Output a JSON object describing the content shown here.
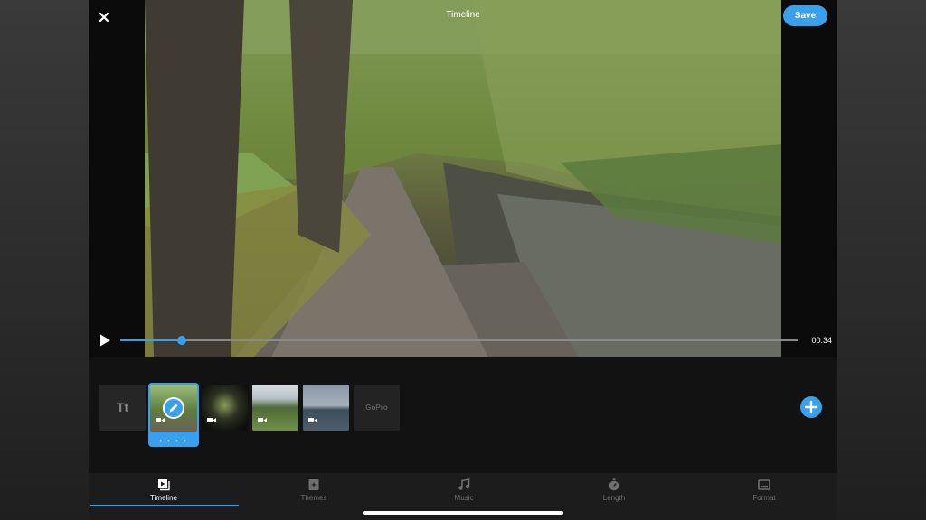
{
  "header": {
    "title": "Timeline",
    "save_label": "Save"
  },
  "player": {
    "current_time": "00:34",
    "progress": 0.09
  },
  "clips": {
    "title_card_label": "Tt",
    "selected_indicator": "• • • •",
    "logo_text": "GoPro"
  },
  "tabs": [
    {
      "label": "Timeline",
      "icon": "timeline-icon",
      "active": true
    },
    {
      "label": "Themes",
      "icon": "themes-icon",
      "active": false
    },
    {
      "label": "Music",
      "icon": "music-icon",
      "active": false
    },
    {
      "label": "Length",
      "icon": "stopwatch-icon",
      "active": false
    },
    {
      "label": "Format",
      "icon": "format-icon",
      "active": false
    }
  ],
  "colors": {
    "accent": "#3aa0ec",
    "background": "#121212",
    "tabbar": "#1c1c1c"
  }
}
